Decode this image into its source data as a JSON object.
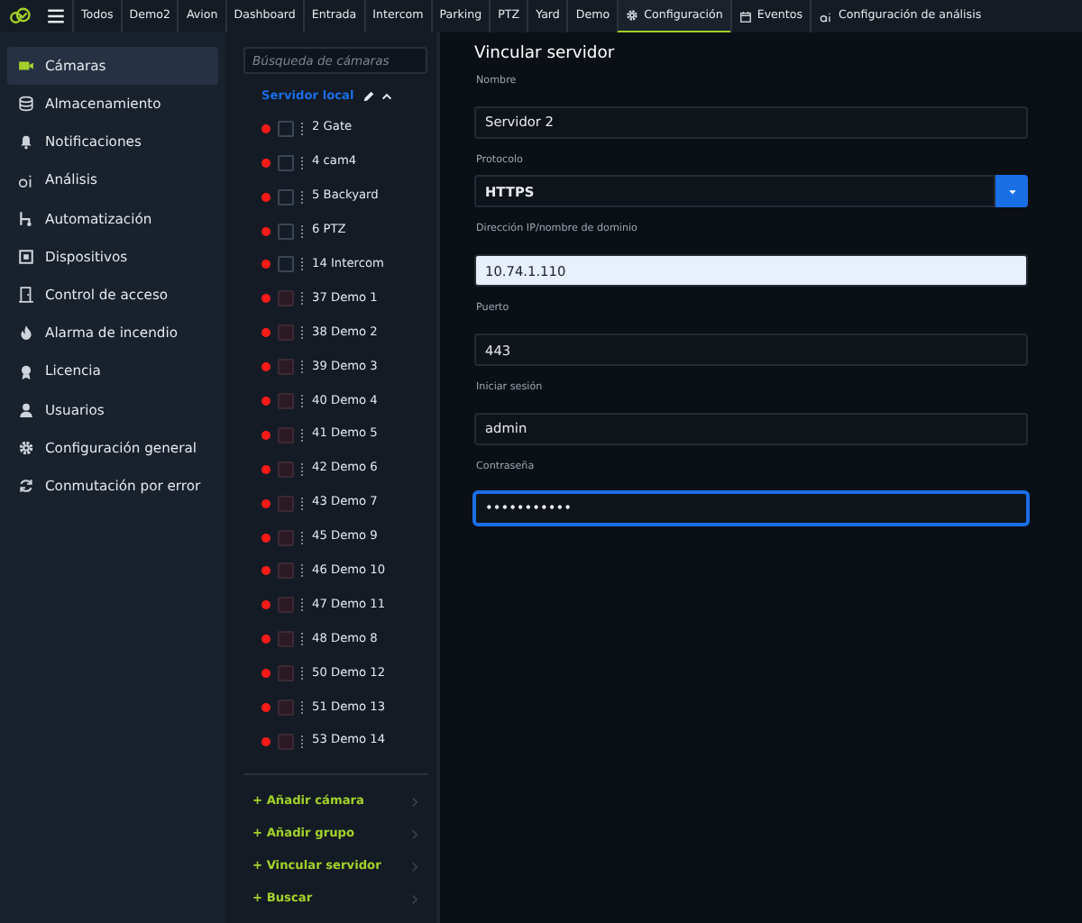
{
  "top_nav": [
    {
      "label": "Todos",
      "selected": false
    },
    {
      "label": "Demo2",
      "selected": false
    },
    {
      "label": "Avion",
      "selected": false
    },
    {
      "label": "Dashboard",
      "selected": false
    },
    {
      "label": "Entrada",
      "selected": false
    },
    {
      "label": "Intercom",
      "selected": false
    },
    {
      "label": "Parking",
      "selected": false
    },
    {
      "label": "PTZ",
      "selected": false
    },
    {
      "label": "Yard",
      "selected": false
    },
    {
      "label": "Demo",
      "selected": false
    },
    {
      "label": "Configuración",
      "selected": true,
      "kind": "settings"
    },
    {
      "label": "Eventos",
      "selected": false,
      "kind": "events"
    },
    {
      "label": "Configuración de análisis",
      "selected": false,
      "kind": "analytics"
    }
  ],
  "sidebar": {
    "items": [
      {
        "label": "Cámaras",
        "selected": true
      },
      {
        "label": "Almacenamiento",
        "selected": false
      },
      {
        "label": "Notificaciones",
        "selected": false
      },
      {
        "label": "Análisis",
        "selected": false
      },
      {
        "label": "Automatización",
        "selected": false
      },
      {
        "label": "Dispositivos",
        "selected": false
      },
      {
        "label": "Control de acceso",
        "selected": false
      },
      {
        "label": "Alarma de incendio",
        "selected": false
      },
      {
        "label": "Licencia",
        "selected": false
      },
      {
        "label": "Usuarios",
        "selected": false
      },
      {
        "label": "Configuración general",
        "selected": false
      },
      {
        "label": "Conmutación por error",
        "selected": false
      }
    ]
  },
  "camera_panel": {
    "search": {
      "placeholder": "Búsqueda de cámaras"
    },
    "server": {
      "label": "Servidor local",
      "expanded": true
    },
    "cameras": [
      {
        "label": "2 Gate",
        "online": false,
        "disabled": false
      },
      {
        "label": "4 cam4",
        "online": false,
        "disabled": false
      },
      {
        "label": "5 Backyard",
        "online": false,
        "disabled": false
      },
      {
        "label": "6 PTZ",
        "online": false,
        "disabled": false
      },
      {
        "label": "14 Intercom",
        "online": false,
        "disabled": false
      },
      {
        "label": "37 Demo 1",
        "online": false,
        "disabled": true
      },
      {
        "label": "38 Demo 2",
        "online": false,
        "disabled": true
      },
      {
        "label": "39 Demo 3",
        "online": false,
        "disabled": true
      },
      {
        "label": "40 Demo 4",
        "online": false,
        "disabled": true
      },
      {
        "label": "41 Demo 5",
        "online": false,
        "disabled": true
      },
      {
        "label": "42 Demo 6",
        "online": false,
        "disabled": true
      },
      {
        "label": "43 Demo 7",
        "online": false,
        "disabled": true
      },
      {
        "label": "45 Demo 9",
        "online": false,
        "disabled": true
      },
      {
        "label": "46 Demo 10",
        "online": false,
        "disabled": true
      },
      {
        "label": "47 Demo 11",
        "online": false,
        "disabled": true
      },
      {
        "label": "48 Demo 8",
        "online": false,
        "disabled": true
      },
      {
        "label": "50 Demo 12",
        "online": false,
        "disabled": true
      },
      {
        "label": "51 Demo 13",
        "online": false,
        "disabled": true
      },
      {
        "label": "53 Demo 14",
        "online": false,
        "disabled": true
      }
    ],
    "actions": [
      "+ Añadir cámara",
      "+ Añadir grupo",
      "+ Vincular servidor",
      "+ Buscar"
    ]
  },
  "form": {
    "title": "Vincular servidor",
    "fields": [
      {
        "label": "Nombre",
        "value": "Servidor 2",
        "kind": "text"
      },
      {
        "label": "Protocolo",
        "value": "HTTPS",
        "kind": "select"
      },
      {
        "label": "Dirección IP/nombre de dominio",
        "value": "10.74.1.110",
        "kind": "text",
        "autofilled": true
      },
      {
        "label": "Puerto",
        "value": "443",
        "kind": "text"
      },
      {
        "label": "Iniciar sesión",
        "value": "admin",
        "kind": "text"
      },
      {
        "label": "Contraseña",
        "value": "•••••••••••",
        "kind": "text",
        "focused": true
      }
    ]
  }
}
